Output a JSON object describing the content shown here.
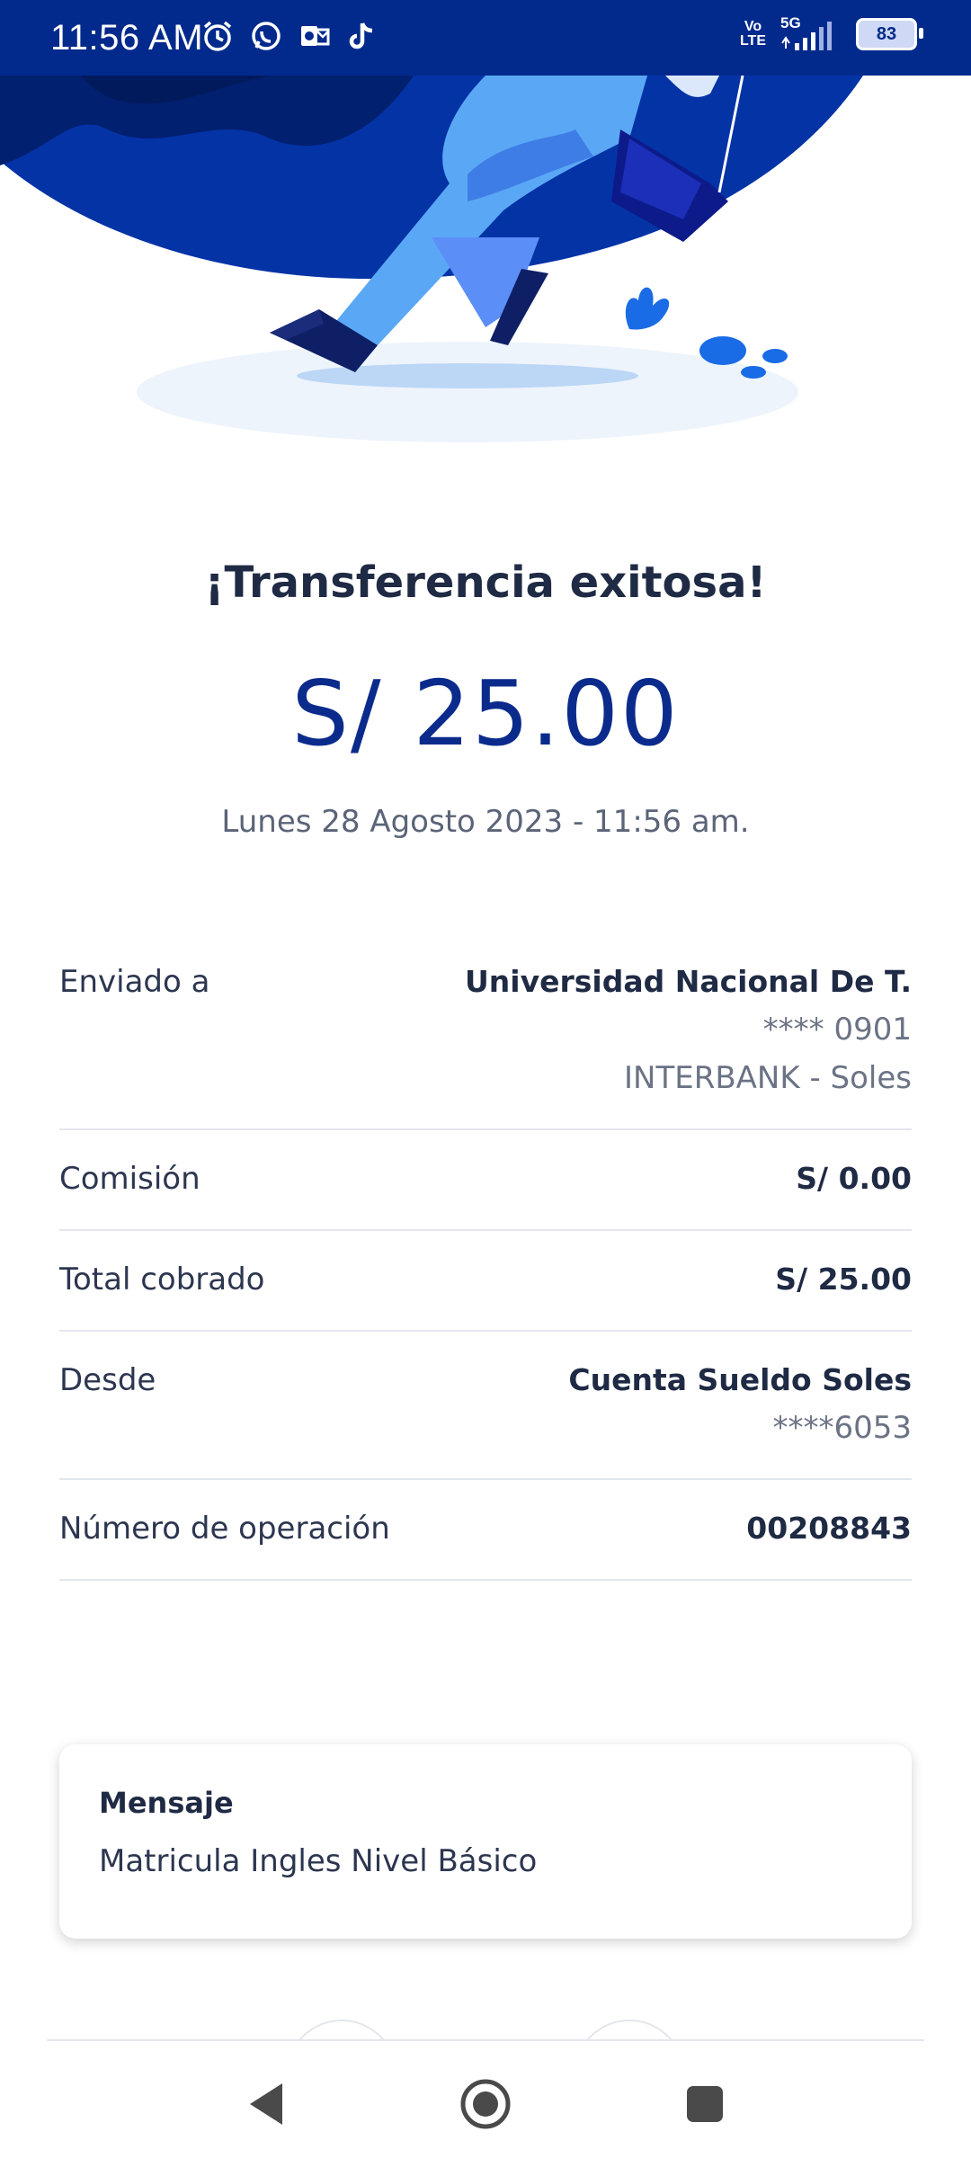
{
  "status_bar": {
    "time": "11:56 AM",
    "network": "5G",
    "volte_top": "Vo",
    "volte_bottom": "LTE",
    "battery": "83"
  },
  "success": {
    "title": "¡Transferencia exitosa!",
    "amount": "S/ 25.00",
    "datetime": "Lunes 28 Agosto 2023 - 11:56 am."
  },
  "details": {
    "sent_to": {
      "label": "Enviado a",
      "name": "Universidad Nacional De T.",
      "account": "**** 0901",
      "bank": "INTERBANK - Soles"
    },
    "commission": {
      "label": "Comisión",
      "value": "S/ 0.00"
    },
    "total": {
      "label": "Total cobrado",
      "value": "S/ 25.00"
    },
    "from": {
      "label": "Desde",
      "account_name": "Cuenta Sueldo Soles",
      "account_number": "****6053"
    },
    "operation": {
      "label": "Número de operación",
      "value": "00208843"
    }
  },
  "message": {
    "title": "Mensaje",
    "text": "Matricula Ingles Nivel Básico"
  },
  "colors": {
    "primary": "#0b2b8c",
    "status_bar": "#022a8c",
    "illustration_light": "#5aa8f5"
  },
  "icons": {
    "status": [
      "alarm-icon",
      "whatsapp-icon",
      "outlook-icon",
      "tiktok-icon"
    ],
    "nav": [
      "back-icon",
      "home-icon",
      "recents-icon"
    ]
  }
}
